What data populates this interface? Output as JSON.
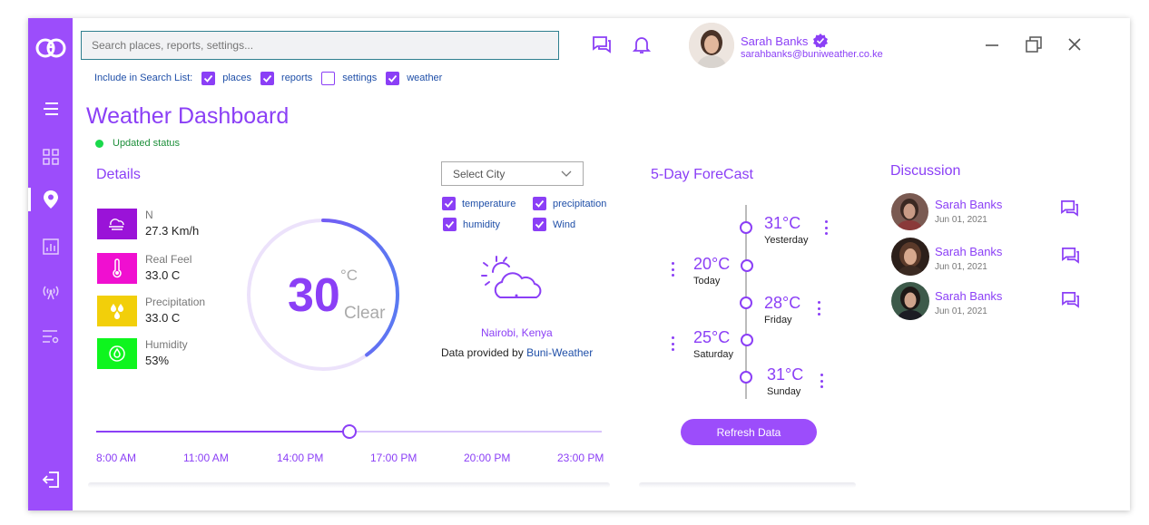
{
  "search": {
    "placeholder": "Search places, reports, settings..."
  },
  "filters": {
    "label": "Include in Search List:",
    "items": [
      {
        "label": "places",
        "checked": true
      },
      {
        "label": "reports",
        "checked": true
      },
      {
        "label": "settings",
        "checked": false
      },
      {
        "label": "weather",
        "checked": true
      }
    ]
  },
  "user": {
    "name": "Sarah Banks",
    "email": "sarahbanks@buniweather.co.ke"
  },
  "page": {
    "title": "Weather Dashboard",
    "status": "Updated status"
  },
  "details": {
    "heading": "Details",
    "metrics": [
      {
        "label": "N",
        "value": "27.3 Km/h",
        "color": "#9a13d8",
        "icon": "wind-icon"
      },
      {
        "label": "Real Feel",
        "value": "33.0 C",
        "color": "#f00fd0",
        "icon": "thermometer-icon"
      },
      {
        "label": "Precipitation",
        "value": "33.0 C",
        "color": "#f2cf0a",
        "icon": "raindrops-icon"
      },
      {
        "label": "Humidity",
        "value": "53%",
        "color": "#0ef51e",
        "icon": "humidity-icon"
      }
    ],
    "temperature": "30",
    "unit": "°C",
    "condition": "Clear",
    "gauge_fraction": 0.4
  },
  "city": {
    "select_placeholder": "Select City",
    "options": [
      {
        "label": "temperature",
        "checked": true
      },
      {
        "label": "precipitation",
        "checked": true
      },
      {
        "label": "humidity",
        "checked": true
      },
      {
        "label": "Wind",
        "checked": true
      }
    ],
    "location": "Nairobi, Kenya",
    "provided_prefix": "Data provided by ",
    "provider": "Buni-Weather"
  },
  "timeline": {
    "times": [
      "8:00 AM",
      "11:00 AM",
      "14:00 PM",
      "17:00 PM",
      "20:00 PM",
      "23:00 PM"
    ],
    "position": 0.5
  },
  "forecast": {
    "heading": "5-Day ForeCast",
    "days": [
      {
        "temp": "31°C",
        "day": "Yesterday"
      },
      {
        "temp": "20°C",
        "day": "Today"
      },
      {
        "temp": "28°C",
        "day": "Friday"
      },
      {
        "temp": "25°C",
        "day": "Saturday"
      },
      {
        "temp": "31°C",
        "day": "Sunday"
      }
    ],
    "refresh_label": "Refresh Data"
  },
  "discussion": {
    "heading": "Discussion",
    "items": [
      {
        "name": "Sarah Banks",
        "date": "Jun 01, 2021"
      },
      {
        "name": "Sarah Banks",
        "date": "Jun 01, 2021"
      },
      {
        "name": "Sarah Banks",
        "date": "Jun 01, 2021"
      }
    ]
  },
  "colors": {
    "accent": "#9c4dfb",
    "text_accent": "#8b3ff6",
    "link": "#1f4fa8"
  }
}
